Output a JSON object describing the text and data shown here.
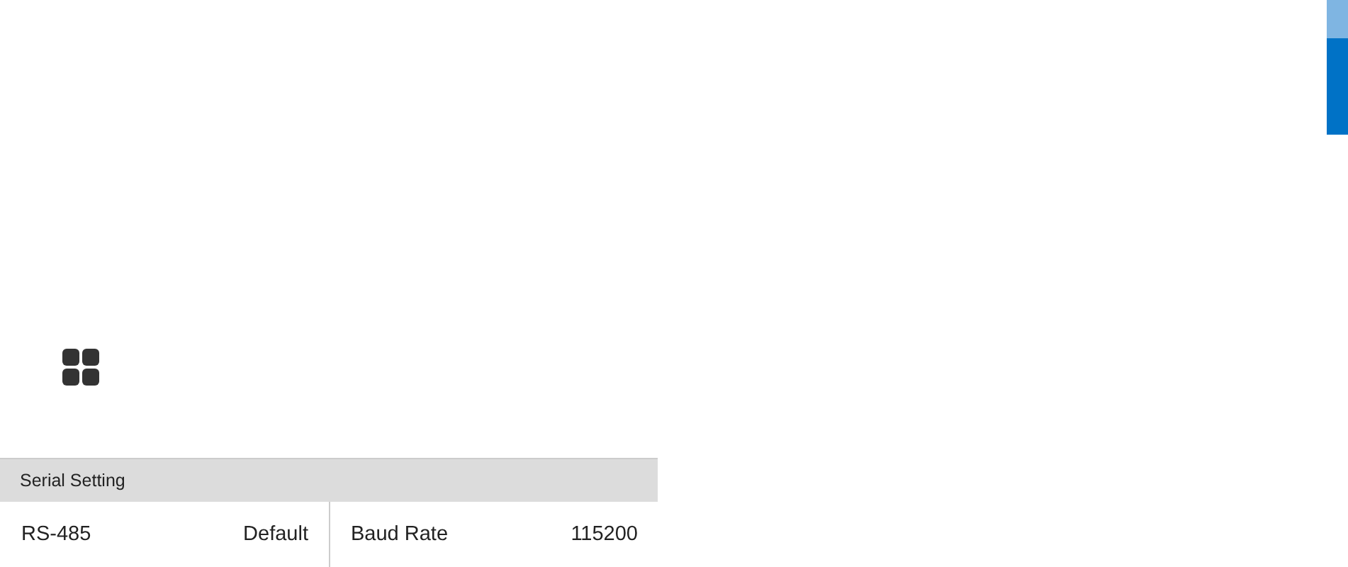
{
  "panel": {
    "title": "Serial Setting",
    "cells": [
      {
        "label": "RS-485",
        "value": "Default"
      },
      {
        "label": "Baud Rate",
        "value": "115200"
      }
    ]
  }
}
